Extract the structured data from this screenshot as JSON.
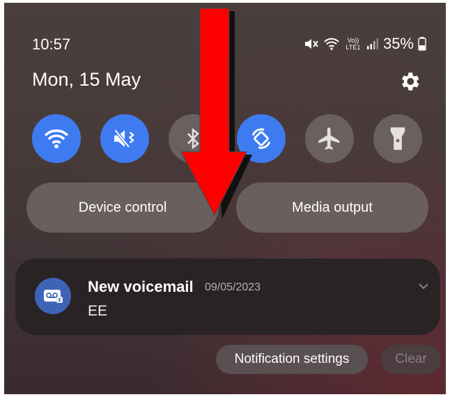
{
  "status_bar": {
    "time": "10:57",
    "volte_label": "Vo)) LTE1",
    "battery_percent": "35%"
  },
  "header": {
    "date": "Mon, 15 May"
  },
  "quick_settings": [
    {
      "name": "wifi-icon",
      "state": "on"
    },
    {
      "name": "vibrate-icon",
      "state": "on"
    },
    {
      "name": "bluetooth-icon",
      "state": "off"
    },
    {
      "name": "auto-rotate-icon",
      "state": "on"
    },
    {
      "name": "airplane-icon",
      "state": "off"
    },
    {
      "name": "flashlight-icon",
      "state": "off"
    }
  ],
  "panels": {
    "device_control": "Device control",
    "media_output": "Media output"
  },
  "notification": {
    "title": "New voicemail",
    "date": "09/05/2023",
    "body": "EE"
  },
  "actions": {
    "notification_settings": "Notification settings",
    "clear": "Clear"
  },
  "colors": {
    "tile_on": "#3e7bf0",
    "tile_off": "#6b6060",
    "annotation_arrow": "#ff0000"
  }
}
